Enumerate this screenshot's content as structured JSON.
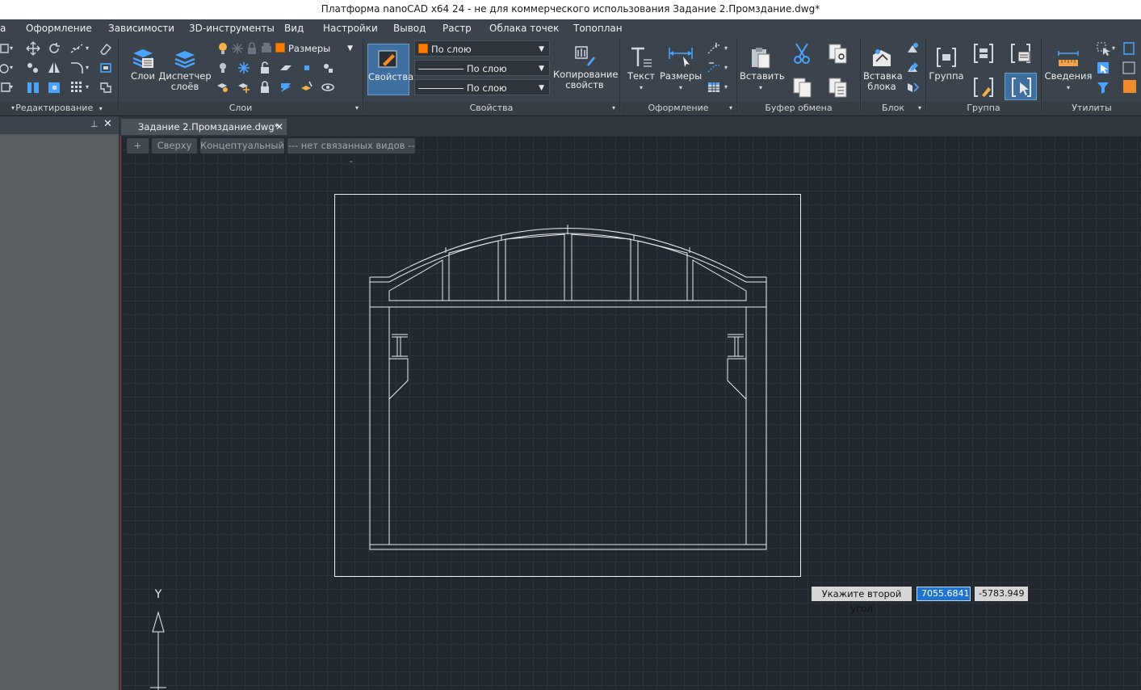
{
  "titlebar": {
    "title": "Платформа nanoCAD x64 24 - не для коммерческого использования Задание 2.Промздание.dwg*"
  },
  "menu": [
    "Оформление",
    "Зависимости",
    "3D-инструменты",
    "Вид",
    "Настройки",
    "Вывод",
    "Растр",
    "Облака точек",
    "Топоплан"
  ],
  "ribbon": {
    "panels": {
      "edit": "Редактирование",
      "layers": "Слои",
      "props": "Свойства",
      "design": "Оформление",
      "clipboard": "Буфер обмена",
      "block": "Блок",
      "group": "Группа",
      "utils": "Утилиты"
    },
    "layers_btn": "Слои",
    "layer_manager_1": "Диспетчер",
    "layer_manager_2": "слоёв",
    "layer_combo": "Размеры",
    "props_btn": "Свойства",
    "color_combo": "По слою",
    "linetype_combo": "По слою",
    "lineweight_combo": "По слою",
    "copy_props_1": "Копирование",
    "copy_props_2": "свойств",
    "text_btn": "Текст",
    "dims_btn": "Размеры",
    "paste_btn": "Вставить",
    "insert_block_1": "Вставка",
    "insert_block_2": "блока",
    "group_btn": "Группа",
    "info_btn": "Сведения"
  },
  "document": {
    "tab": "Задание 2.Промздание.dwg*",
    "view_buttons": [
      "+",
      "Сверху",
      "Концептуальный",
      "--- нет связанных видов ---"
    ]
  },
  "prompt": {
    "label": "Укажите второй угол",
    "x": "7055.6841",
    "y": "-5783.949"
  },
  "ucs": {
    "y_label": "Y"
  },
  "colors": {
    "accent": "#1e73d1",
    "layer_color": "#ff7b00",
    "ribbon_bg": "#3b444d",
    "canvas_bg": "#212830"
  }
}
